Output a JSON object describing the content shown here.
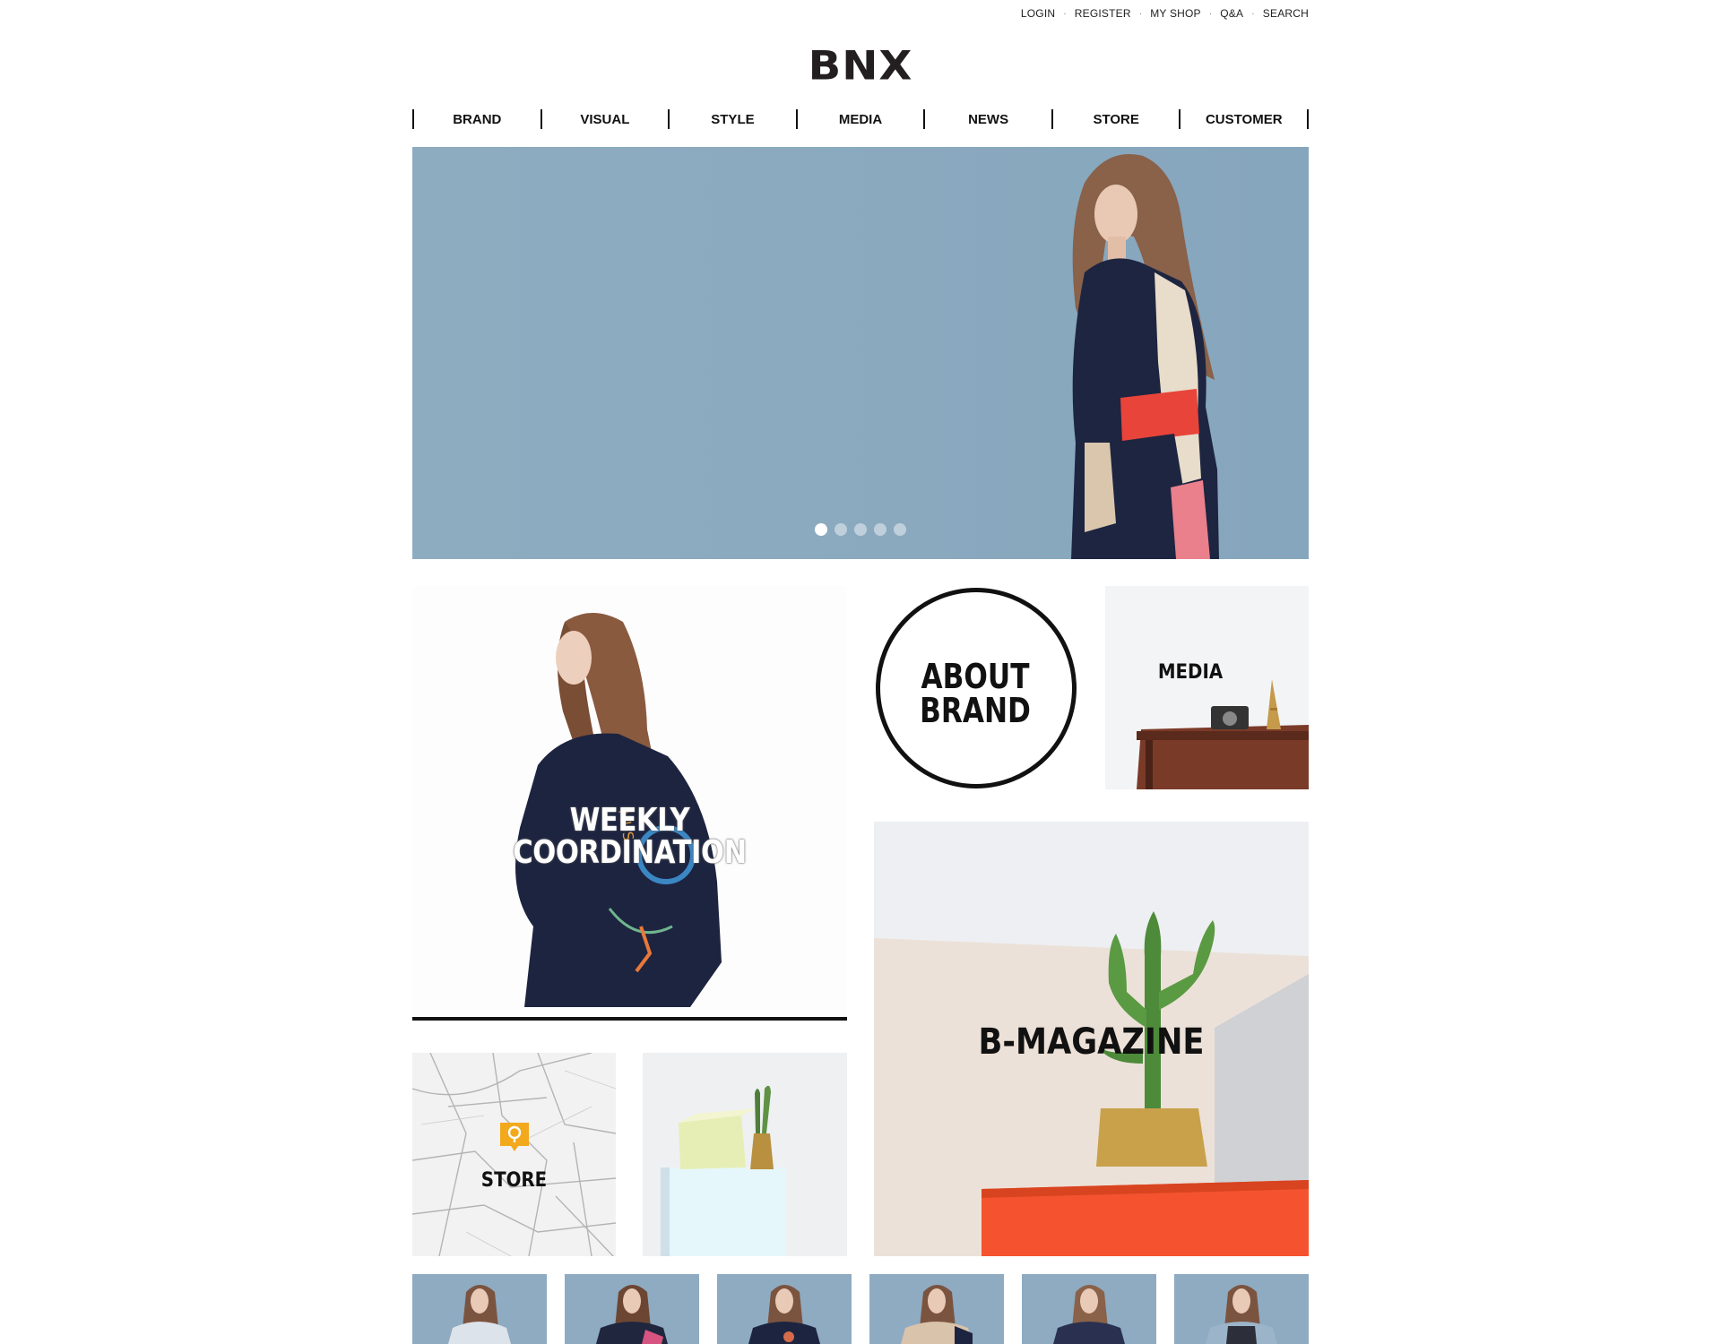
{
  "util_links": [
    "LOGIN",
    "REGISTER",
    "MY SHOP",
    "Q&A",
    "SEARCH"
  ],
  "logo": "BNX",
  "gnb": [
    "BRAND",
    "VISUAL",
    "STYLE",
    "MEDIA",
    "NEWS",
    "STORE",
    "CUSTOMER"
  ],
  "hero": {
    "slide_count": 5,
    "active_slide": 1
  },
  "tiles": {
    "weekly": {
      "line1": "WEEKLY",
      "line2": "COORDINATION"
    },
    "about": {
      "line1": "ABOUT",
      "line2": "BRAND"
    },
    "media": "MEDIA",
    "bmagazine": "B-MAGAZINE",
    "store": "STORE"
  },
  "thumbnail_count": 6,
  "colors": {
    "hero_bg": "#8aa9bf",
    "accent_red": "#e8443a",
    "map_pin": "#f2a91c"
  }
}
